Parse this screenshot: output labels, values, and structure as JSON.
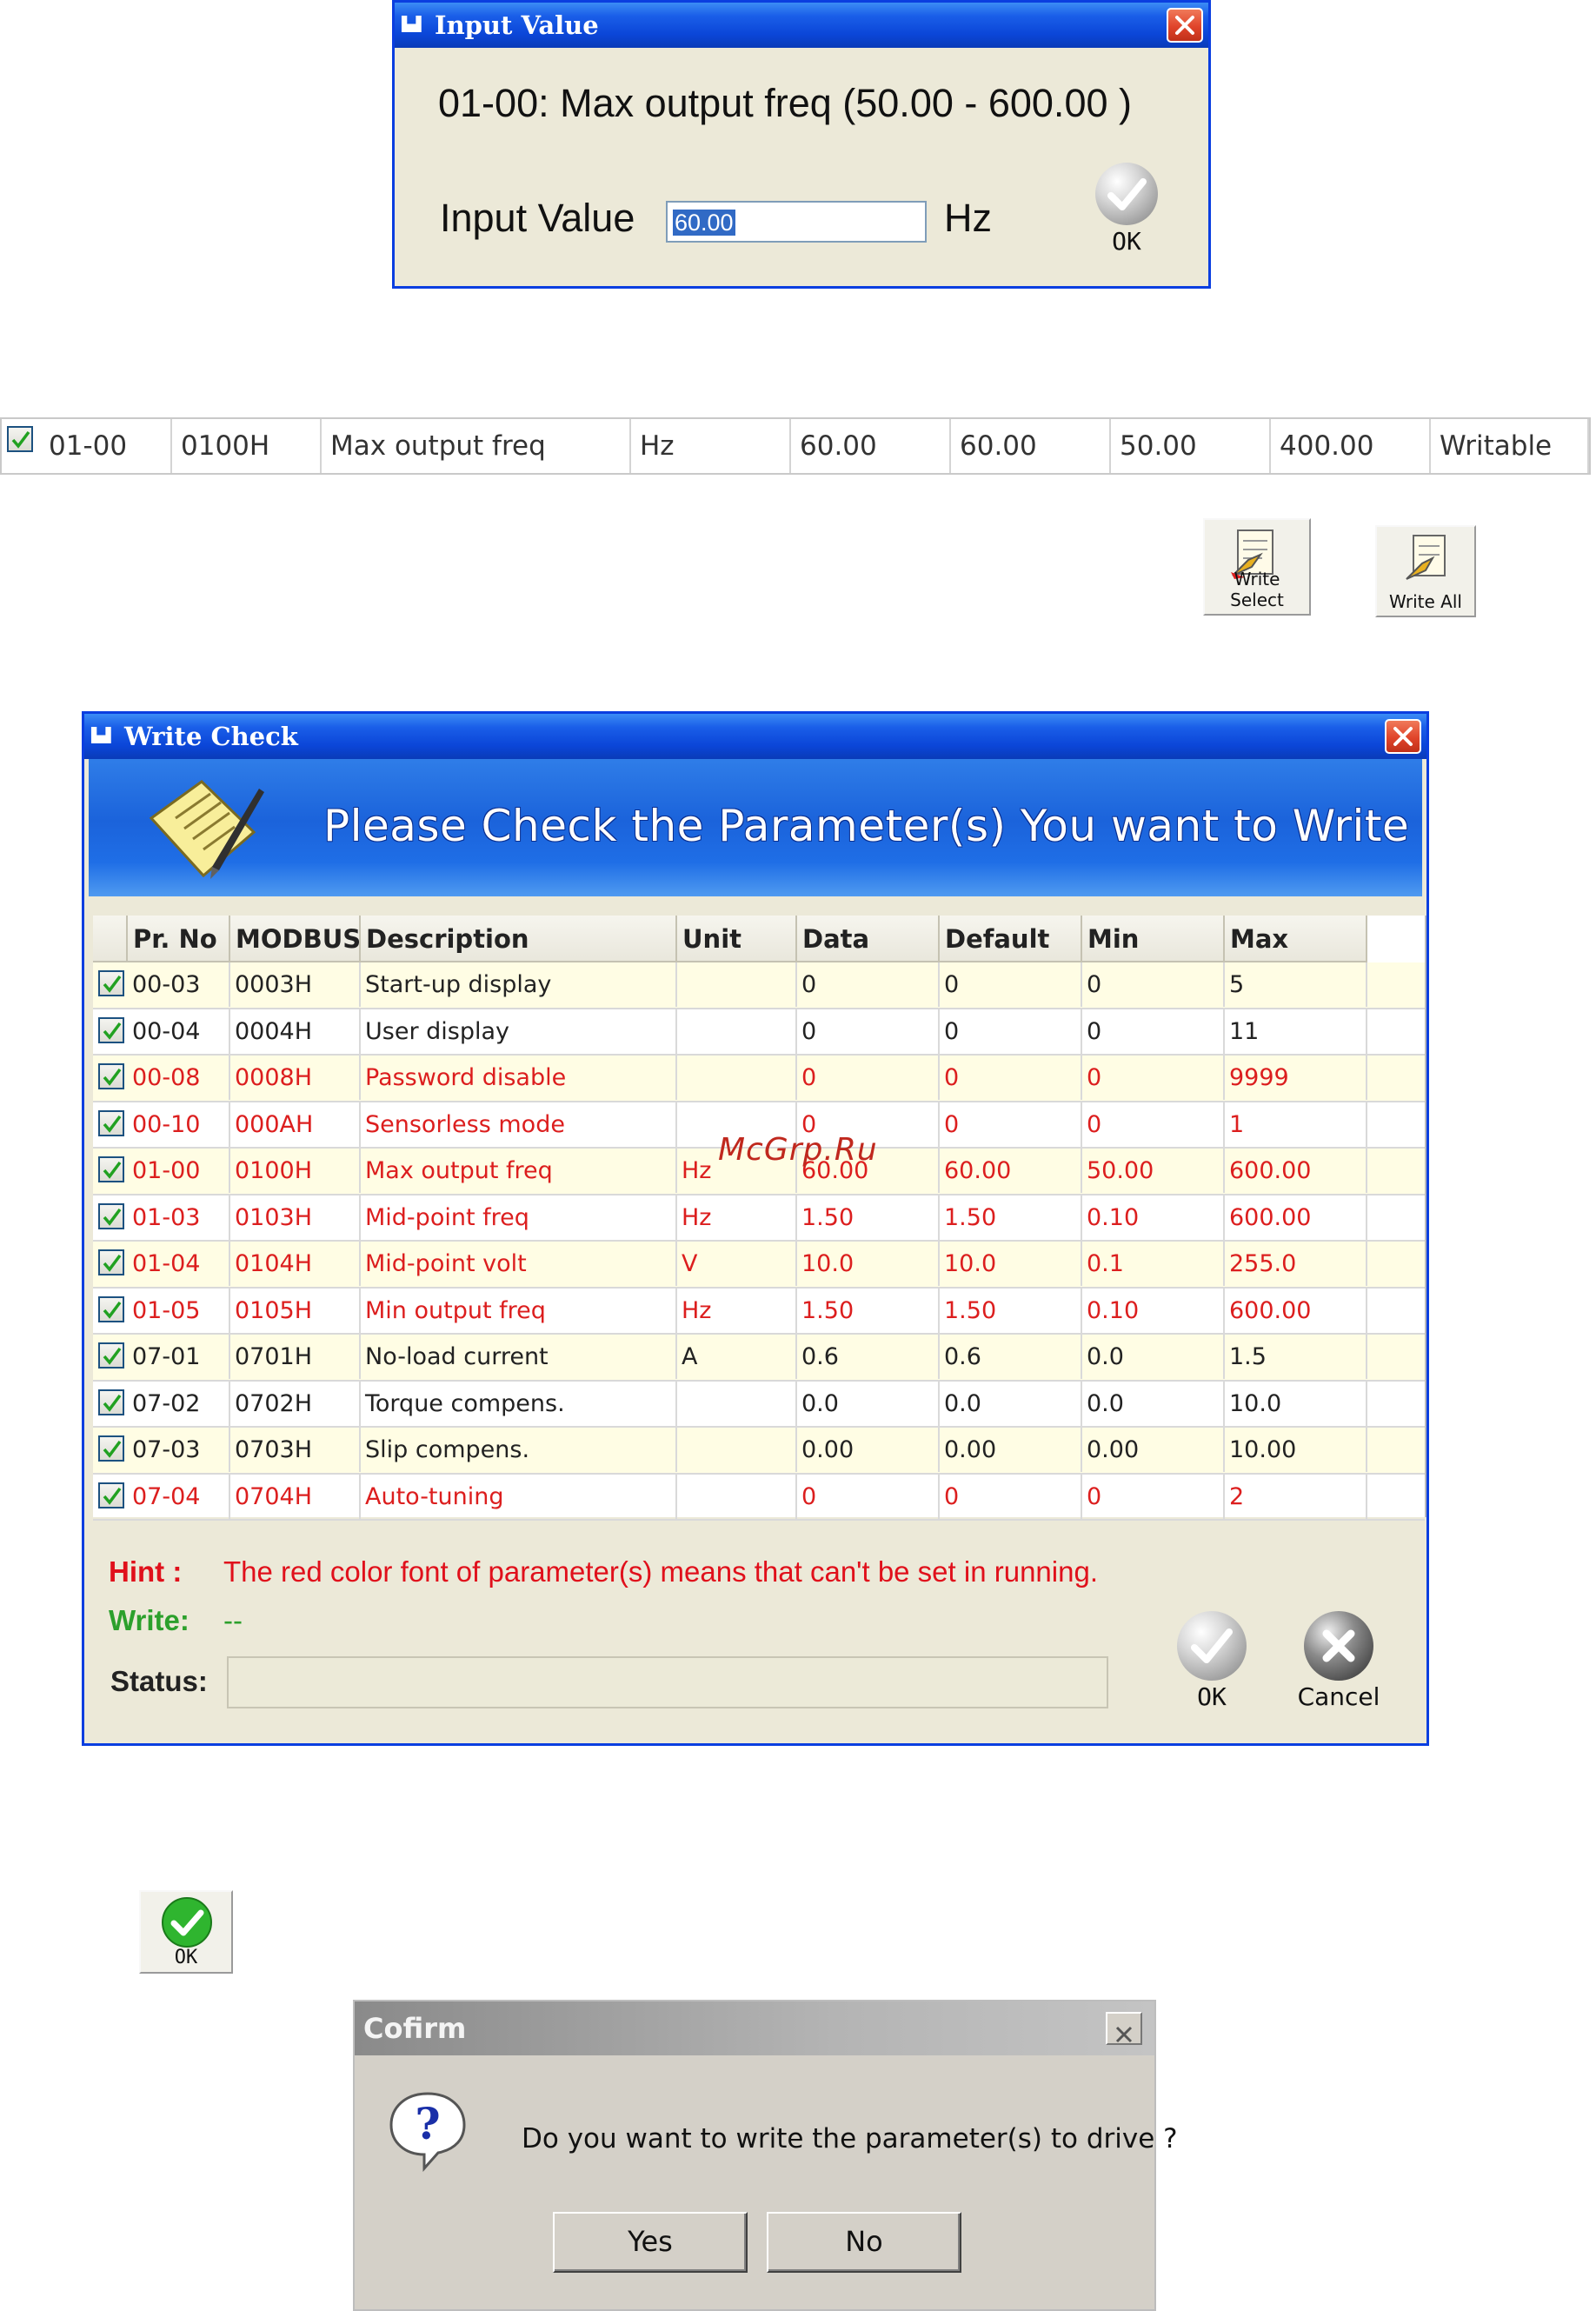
{
  "input_value_dialog": {
    "title": "Input Value",
    "heading": "01-00: Max output freq  (50.00 - 600.00 )",
    "label": "Input Value",
    "value": "60.00",
    "unit": "Hz",
    "ok_label": "OK"
  },
  "param_row": {
    "checked": true,
    "cells": [
      "01-00",
      "0100H",
      "Max output freq",
      "Hz",
      "60.00",
      "60.00",
      "50.00",
      "400.00",
      "Writable"
    ]
  },
  "toolbar": {
    "write_select_label": "Write Select",
    "write_all_label": "Write All"
  },
  "write_check_dialog": {
    "title": "Write Check",
    "banner": "Please Check the Parameter(s) You want to Write",
    "columns": [
      "Pr. No",
      "MODBUS",
      "Description",
      "Unit",
      "Data",
      "Default",
      "Min",
      "Max"
    ],
    "rows": [
      {
        "color": "black",
        "cells": [
          "00-03",
          "0003H",
          "Start-up display",
          "",
          "0",
          "0",
          "0",
          "5"
        ]
      },
      {
        "color": "black",
        "cells": [
          "00-04",
          "0004H",
          "User display",
          "",
          "0",
          "0",
          "0",
          "11"
        ]
      },
      {
        "color": "red",
        "cells": [
          "00-08",
          "0008H",
          "Password disable",
          "",
          "0",
          "0",
          "0",
          "9999"
        ]
      },
      {
        "color": "red",
        "cells": [
          "00-10",
          "000AH",
          "Sensorless mode",
          "",
          "0",
          "0",
          "0",
          "1"
        ]
      },
      {
        "color": "red",
        "cells": [
          "01-00",
          "0100H",
          "Max output freq",
          "Hz",
          "60.00",
          "60.00",
          "50.00",
          "600.00"
        ]
      },
      {
        "color": "red",
        "cells": [
          "01-03",
          "0103H",
          "Mid-point freq",
          "Hz",
          "1.50",
          "1.50",
          "0.10",
          "600.00"
        ]
      },
      {
        "color": "red",
        "cells": [
          "01-04",
          "0104H",
          "Mid-point volt",
          "V",
          "10.0",
          "10.0",
          "0.1",
          "255.0"
        ]
      },
      {
        "color": "red",
        "cells": [
          "01-05",
          "0105H",
          "Min output freq",
          "Hz",
          "1.50",
          "1.50",
          "0.10",
          "600.00"
        ]
      },
      {
        "color": "black",
        "cells": [
          "07-01",
          "0701H",
          "No-load current",
          "A",
          "0.6",
          "0.6",
          "0.0",
          "1.5"
        ]
      },
      {
        "color": "black",
        "cells": [
          "07-02",
          "0702H",
          "Torque compens.",
          "",
          "0.0",
          "0.0",
          "0.0",
          "10.0"
        ]
      },
      {
        "color": "black",
        "cells": [
          "07-03",
          "0703H",
          "Slip compens.",
          "",
          "0.00",
          "0.00",
          "0.00",
          "10.00"
        ]
      },
      {
        "color": "red",
        "cells": [
          "07-04",
          "0704H",
          "Auto-tuning",
          "",
          "0",
          "0",
          "0",
          "2"
        ]
      }
    ],
    "hint_label": "Hint :",
    "hint_text": "The red color font of parameter(s) means that can't be set in running.",
    "write_label": "Write:",
    "write_value": "--",
    "status_label": "Status:",
    "ok_label": "OK",
    "cancel_label": "Cancel"
  },
  "standalone_ok": {
    "label": "OK"
  },
  "confirm_dialog": {
    "title": "Cofirm",
    "message": "Do you want to write the parameter(s) to drive ?",
    "yes_label": "Yes",
    "no_label": "No"
  },
  "watermark": "McGrp.Ru",
  "colors": {
    "title_blue": "#0b46d8",
    "red_text": "#dc1e1e",
    "green_text": "#2ca02c",
    "row_yellow": "#fffde4"
  }
}
